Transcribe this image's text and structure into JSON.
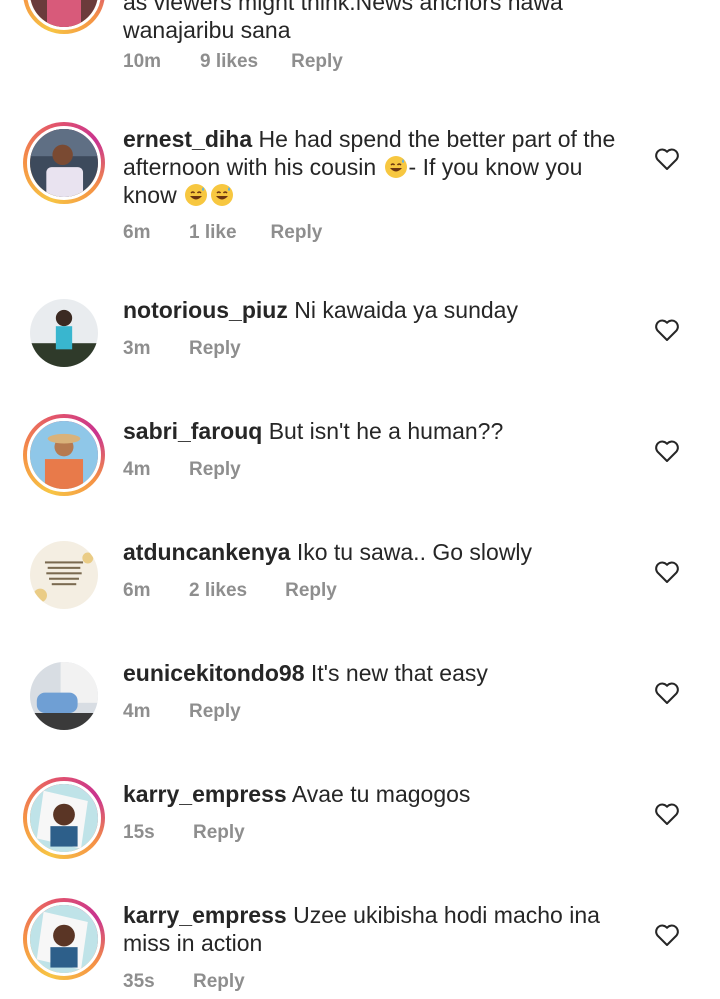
{
  "colors": {
    "text": "#262626",
    "muted": "#8e8e8e",
    "story_ring": "#e3566a"
  },
  "comments": [
    {
      "username": "",
      "text_line1": "as viewers might think.News anchors hawa",
      "text_line2": "wanajaribu sana",
      "time": "10m",
      "likes": "9 likes",
      "reply": "Reply",
      "avatar_icon": "profile-photo"
    },
    {
      "username": "ernest_diha",
      "text_a": "He had spend the better part of the afternoon with his cousin ",
      "text_b": "- If you know you know ",
      "time": "6m",
      "likes": "1 like",
      "reply": "Reply",
      "avatar_icon": "profile-photo"
    },
    {
      "username": "notorious_piuz",
      "text": "Ni kawaida ya sunday",
      "time": "3m",
      "likes": "",
      "reply": "Reply",
      "avatar_icon": "profile-photo"
    },
    {
      "username": "sabri_farouq",
      "text": "But isn't he a human??",
      "time": "4m",
      "likes": "",
      "reply": "Reply",
      "avatar_icon": "profile-photo"
    },
    {
      "username": "atduncankenya",
      "text": "Iko tu sawa.. Go slowly",
      "time": "6m",
      "likes": "2 likes",
      "reply": "Reply",
      "avatar_icon": "quote-card-photo"
    },
    {
      "username": "eunicekitondo98",
      "text": "It's new that easy",
      "time": "4m",
      "likes": "",
      "reply": "Reply",
      "avatar_icon": "profile-photo"
    },
    {
      "username": "karry_empress",
      "text": "Avae tu magogos",
      "time": "15s",
      "likes": "",
      "reply": "Reply",
      "avatar_icon": "profile-photo"
    },
    {
      "username": "karry_empress",
      "text": "Uzee ukibisha hodi macho ina miss in action",
      "time": "35s",
      "likes": "",
      "reply": "Reply",
      "avatar_icon": "profile-photo"
    }
  ],
  "icons": {
    "like": "heart-outline-icon",
    "emoji": "grinning-sweat-emoji"
  }
}
